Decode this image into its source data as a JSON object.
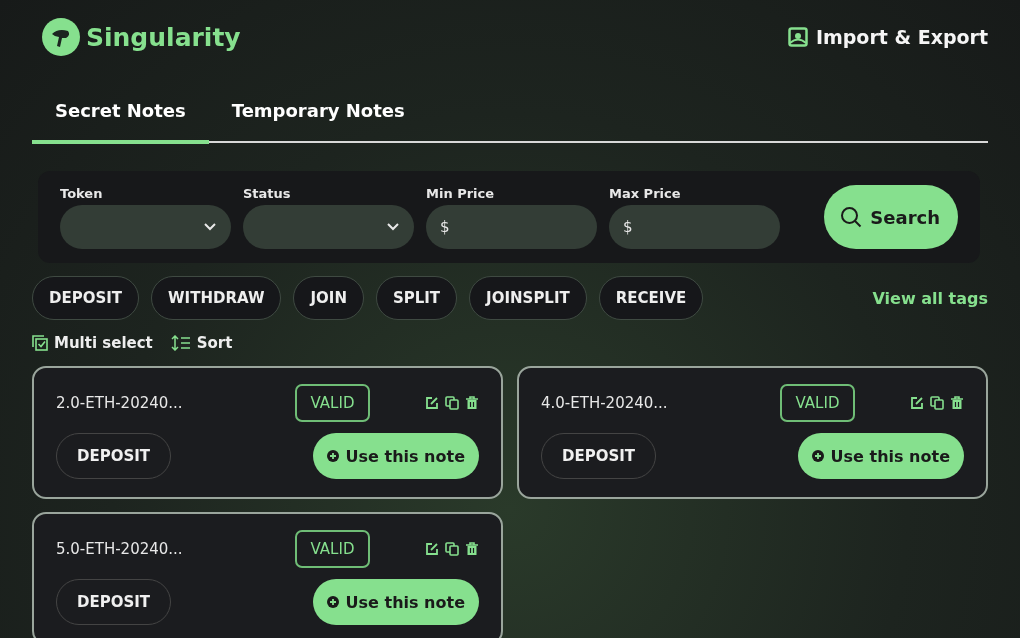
{
  "header": {
    "brand": "Singularity",
    "action": "Import & Export"
  },
  "tabs": [
    {
      "label": "Secret Notes",
      "selected": true
    },
    {
      "label": "Temporary Notes",
      "selected": false
    }
  ],
  "filters": [
    {
      "label": "Token",
      "kind": "select"
    },
    {
      "label": "Status",
      "kind": "select"
    },
    {
      "label": "Min Price",
      "kind": "price",
      "prefix": "$"
    },
    {
      "label": "Max Price",
      "kind": "price",
      "prefix": "$"
    }
  ],
  "search_button": "Search",
  "tags": [
    "DEPOSIT",
    "WITHDRAW",
    "JOIN",
    "SPLIT",
    "JOINSPLIT",
    "RECEIVE"
  ],
  "view_all_tags": "View all tags",
  "toolbar": {
    "multi_select": "Multi select",
    "sort": "Sort"
  },
  "notes": [
    {
      "name": "2.0-ETH-20240...",
      "status": "VALID",
      "tag": "DEPOSIT",
      "action": "Use this note"
    },
    {
      "name": "4.0-ETH-20240...",
      "status": "VALID",
      "tag": "DEPOSIT",
      "action": "Use this note"
    },
    {
      "name": "5.0-ETH-20240...",
      "status": "VALID",
      "tag": "DEPOSIT",
      "action": "Use this note"
    }
  ]
}
